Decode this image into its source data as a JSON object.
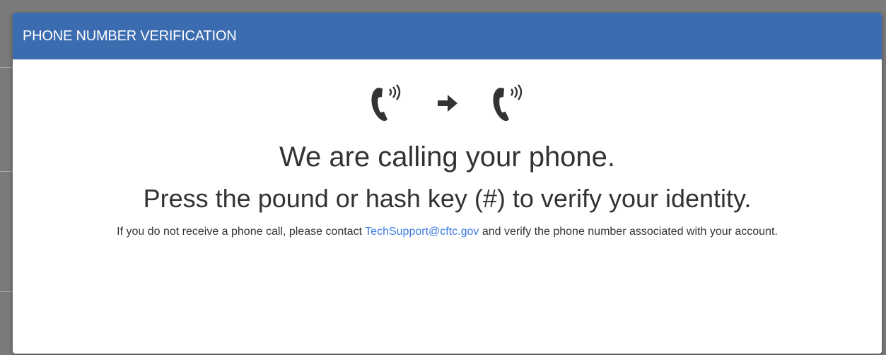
{
  "modal": {
    "title": "PHONE NUMBER VERIFICATION",
    "icons": [
      "phone-ringing-icon",
      "arrow-right-icon",
      "phone-ringing-icon"
    ],
    "headline": "We are calling your phone.",
    "subline": "Press the pound or hash key (#) to verify your identity.",
    "note": {
      "before": "If you do not receive a phone call, please contact",
      "email": "TechSupport@cftc.gov",
      "after": "and verify the phone number associated with your account."
    }
  },
  "colors": {
    "header": "#3c6cb0",
    "link": "#3c7be2",
    "overlay": "#7b7b7b"
  }
}
